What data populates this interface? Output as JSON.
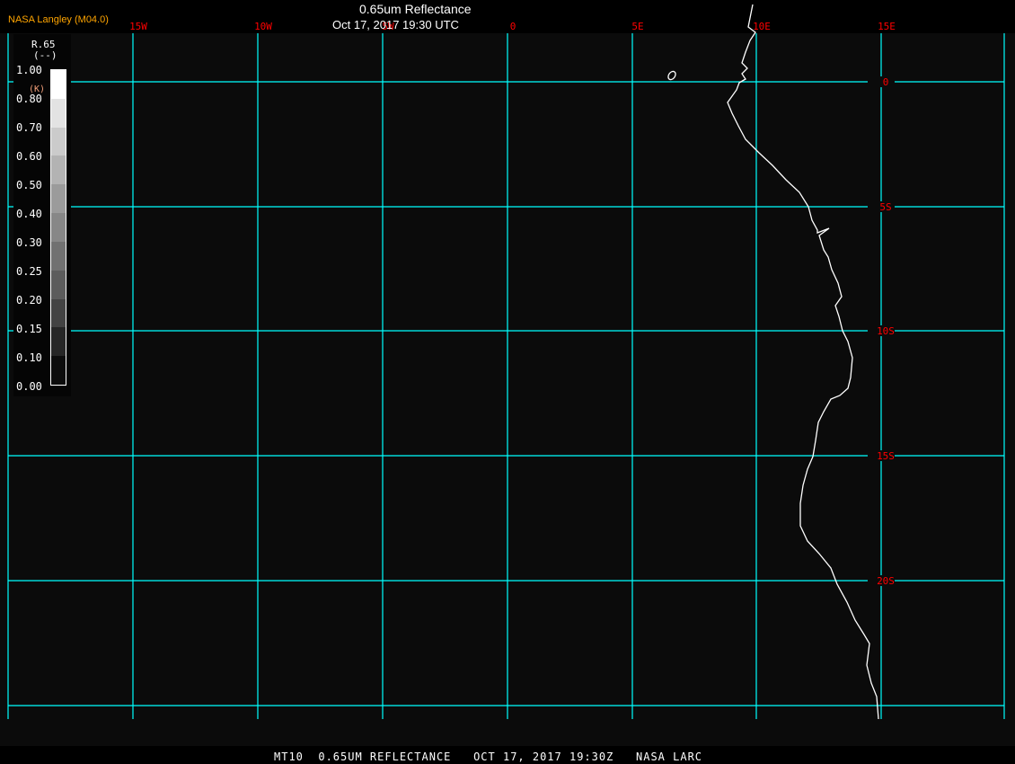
{
  "header": {
    "title": "0.65um Reflectance",
    "datetime": "Oct 17, 2017 19:30 UTC",
    "brand": "NASA Langley (M04.0)"
  },
  "footer": {
    "text": "MT10  0.65UM REFLECTANCE   OCT 17, 2017 19:30Z   NASA LARC"
  },
  "legend": {
    "variable": "R.65",
    "units": "(--)",
    "units_overlay": "(K)",
    "ticks": [
      "1.00",
      "0.80",
      "0.70",
      "0.60",
      "0.50",
      "0.40",
      "0.30",
      "0.25",
      "0.20",
      "0.15",
      "0.10",
      "0.00"
    ],
    "colors": [
      "#ffffff",
      "#e3e3e3",
      "#cbcbcb",
      "#b3b3b3",
      "#9b9b9b",
      "#878787",
      "#717171",
      "#5c5c5c",
      "#434343",
      "#262626",
      "#0c0c0c"
    ]
  },
  "map": {
    "background": "#0b0b0b",
    "grid_color": "#00ffff",
    "label_color": "#ff0000",
    "coast_color": "#ffffff",
    "lon_labels": [
      "15W",
      "10W",
      "5W",
      "0",
      "5E",
      "10E",
      "15E"
    ],
    "lat_labels": [
      "0",
      "5S",
      "10S",
      "15S",
      "20S"
    ]
  }
}
